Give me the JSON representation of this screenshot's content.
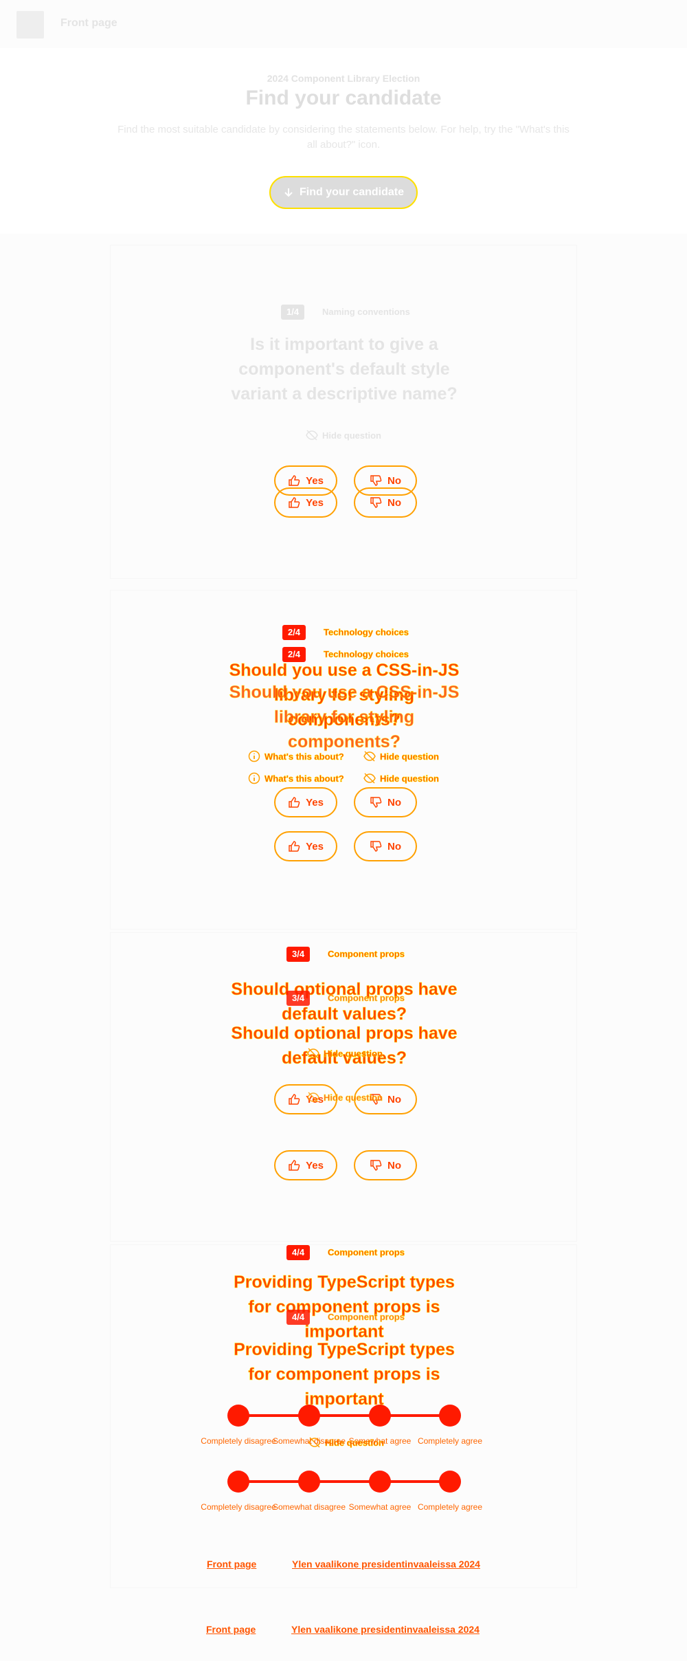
{
  "header": {
    "link": "Front page"
  },
  "hero": {
    "eyebrow": "2024 Component Library Election",
    "title": "Find your candidate",
    "description": "Find the most suitable candidate by considering the statements below. For help, try the \"What's this all about?\" icon.",
    "button_label": "Find your candidate"
  },
  "actions": {
    "whats_this": "What's this about?",
    "hide_question": "Hide question",
    "yes": "Yes",
    "no": "No"
  },
  "questions": [
    {
      "badge": "1/4",
      "category": "Naming conventions",
      "text": "Is it important to give a component's default style variant a descriptive name?"
    },
    {
      "badge": "2/4",
      "category": "Technology choices",
      "text": "Should you use a CSS-in-JS library for styling components?"
    },
    {
      "badge": "3/4",
      "category": "Component props",
      "text": "Should optional props have default values?"
    },
    {
      "badge": "4/4",
      "category": "Component props",
      "text": "Providing TypeScript types for component props is important"
    }
  ],
  "scale": {
    "labels": [
      "Completely disagree",
      "Somewhat disagree",
      "Somewhat agree",
      "Completely agree"
    ]
  },
  "footer": {
    "links": [
      "Front page",
      "Ylen vaalikone presidentinvaaleissa 2024"
    ]
  },
  "colors": {
    "accent": "#ff1a00",
    "focus": "#ffe000"
  }
}
